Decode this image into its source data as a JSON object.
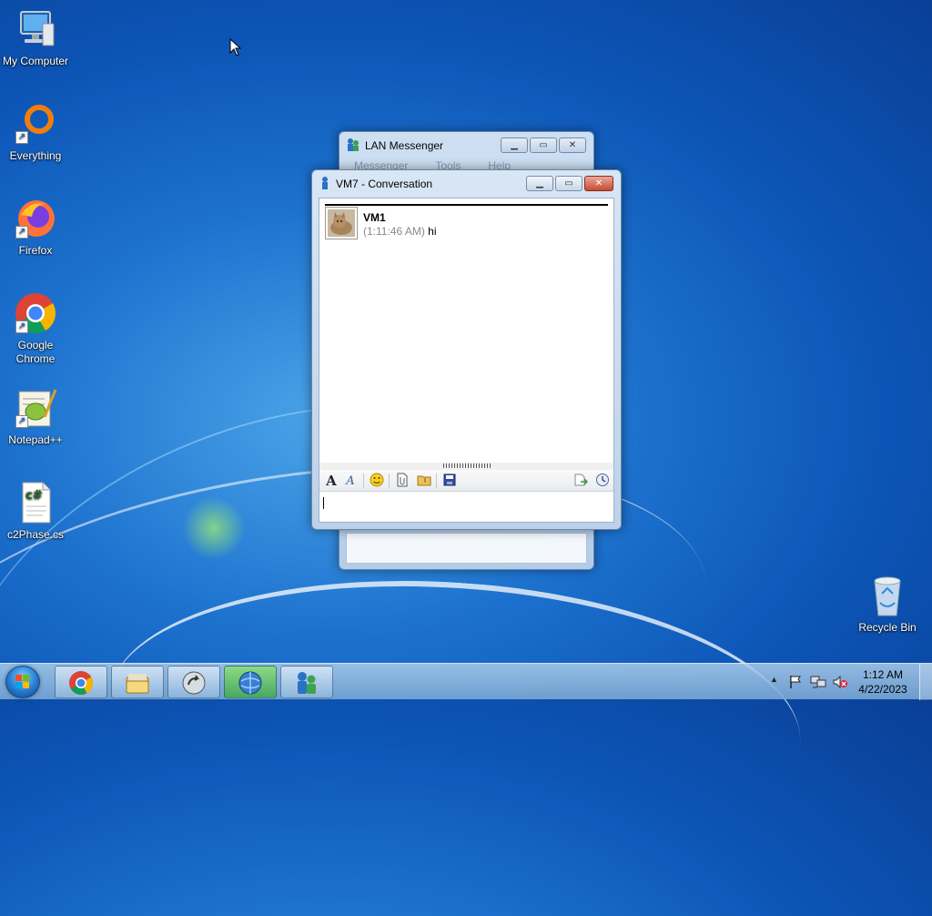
{
  "desktop": {
    "icons": [
      {
        "label": "My Computer",
        "icon": "computer-icon"
      },
      {
        "label": "Everything",
        "icon": "everything-search-icon"
      },
      {
        "label": "Firefox",
        "icon": "firefox-icon"
      },
      {
        "label": "Google Chrome",
        "icon": "chrome-icon"
      },
      {
        "label": "Notepad++",
        "icon": "notepad-plus-plus-icon"
      },
      {
        "label": "c2Phase.cs",
        "icon": "csharp-file-icon"
      },
      {
        "label": "Recycle Bin",
        "icon": "recycle-bin-icon"
      }
    ]
  },
  "lan_messenger": {
    "title": "LAN Messenger",
    "menu": [
      "Messenger",
      "Tools",
      "Help"
    ]
  },
  "conversation": {
    "title": "VM7 - Conversation",
    "messages": [
      {
        "sender": "VM1",
        "time": "(1:11:46 AM)",
        "text": "hi"
      }
    ],
    "toolbar": [
      "font-icon",
      "font-color-icon",
      "emoticon-icon",
      "send-file-icon",
      "send-folder-icon",
      "save-icon",
      "export-icon",
      "history-icon"
    ],
    "input_value": ""
  },
  "taskbar": {
    "apps": [
      "chrome-icon",
      "explorer-icon",
      "app-icon",
      "network-icon",
      "lan-messenger-icon"
    ],
    "clock_time": "1:12 AM",
    "clock_date": "4/22/2023"
  },
  "colors": {
    "title_bar": "#c9dbee",
    "close_button": "#c74a33",
    "taskbar_active": "#3caa46"
  }
}
